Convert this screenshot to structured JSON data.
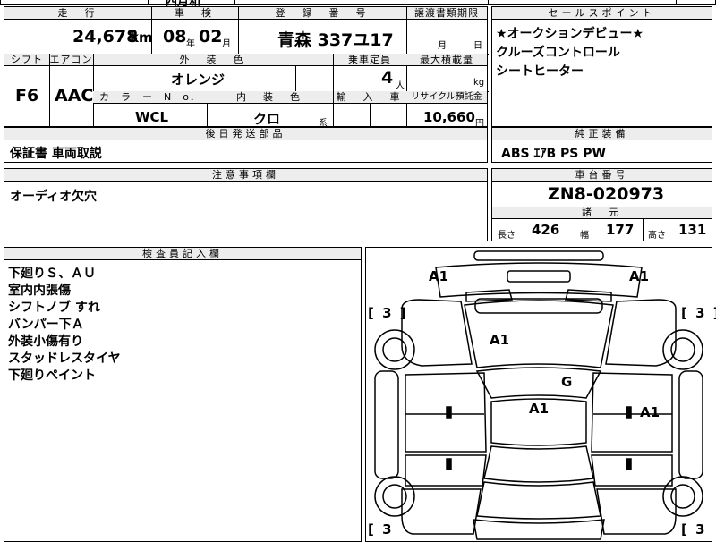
{
  "top_strip": {
    "partial_text": "四月和"
  },
  "vehicle": {
    "headers": {
      "mileage": "走　行",
      "inspection": "車　検",
      "registration": "登　録　番　号",
      "transfer_deadline": "譲渡書類期限",
      "shift": "シフト",
      "aircon": "エアコン",
      "exterior_color": "外　装　色",
      "capacity": "乗車定員",
      "max_load": "最大積載量",
      "color_no": "カ　ラ　ー　N　o．",
      "interior_color": "内　装　色",
      "import": "輸　入　車",
      "recycle_fee": "リサイクル預託金"
    },
    "mileage": "24,678",
    "mileage_unit": "km",
    "inspection_year": "08",
    "inspection_year_unit": "年",
    "inspection_month": "02",
    "inspection_month_unit": "月",
    "registration_number": "青森 337ユ17",
    "transfer_month_unit": "月",
    "transfer_day_unit": "日",
    "shift": "F6",
    "aircon": "AAC",
    "exterior_color": "オレンジ",
    "capacity": "4",
    "capacity_unit": "人",
    "max_load_unit": "kg",
    "color_no": "WCL",
    "interior_color": "クロ",
    "interior_suffix": "系",
    "recycle_fee": "10,660",
    "recycle_fee_unit": "円"
  },
  "sales_points": {
    "header": "セールスポイント",
    "items": [
      "★オークションデビュー★",
      "クルーズコントロール",
      "シートヒーター"
    ]
  },
  "later_parts": {
    "header": "後日発送部品",
    "text": "保証書 車両取説"
  },
  "genuine_equipment": {
    "header": "純正装備",
    "text": "ABS ｴｱB PS PW"
  },
  "notes": {
    "header": "注意事項欄",
    "text": "オーディオ欠穴"
  },
  "chassis": {
    "header": "車台番号",
    "number": "ZN8-020973",
    "specs_header": "諸　元",
    "length_label": "長さ",
    "length": "426",
    "width_label": "幅",
    "width": "177",
    "height_label": "高さ",
    "height": "131"
  },
  "inspector": {
    "header": "検査員記入欄",
    "items": [
      "下廻りＳ、ＡＵ",
      "室内内張傷",
      "シフトノブ すれ",
      "バンパー下Ａ",
      "外装小傷有り",
      "スタッドレスタイヤ",
      "下廻りペイント"
    ]
  },
  "diagram": {
    "marks": {
      "front_left": "A1",
      "front_right": "A1",
      "hood": "A1",
      "windshield": "G",
      "roof": "A1",
      "right_door": "A1"
    },
    "tire_tl": "[ 3 ]",
    "tire_tr": "[ 3 ]",
    "tire_bl": "[ 3",
    "tire_br": "[ 3"
  }
}
